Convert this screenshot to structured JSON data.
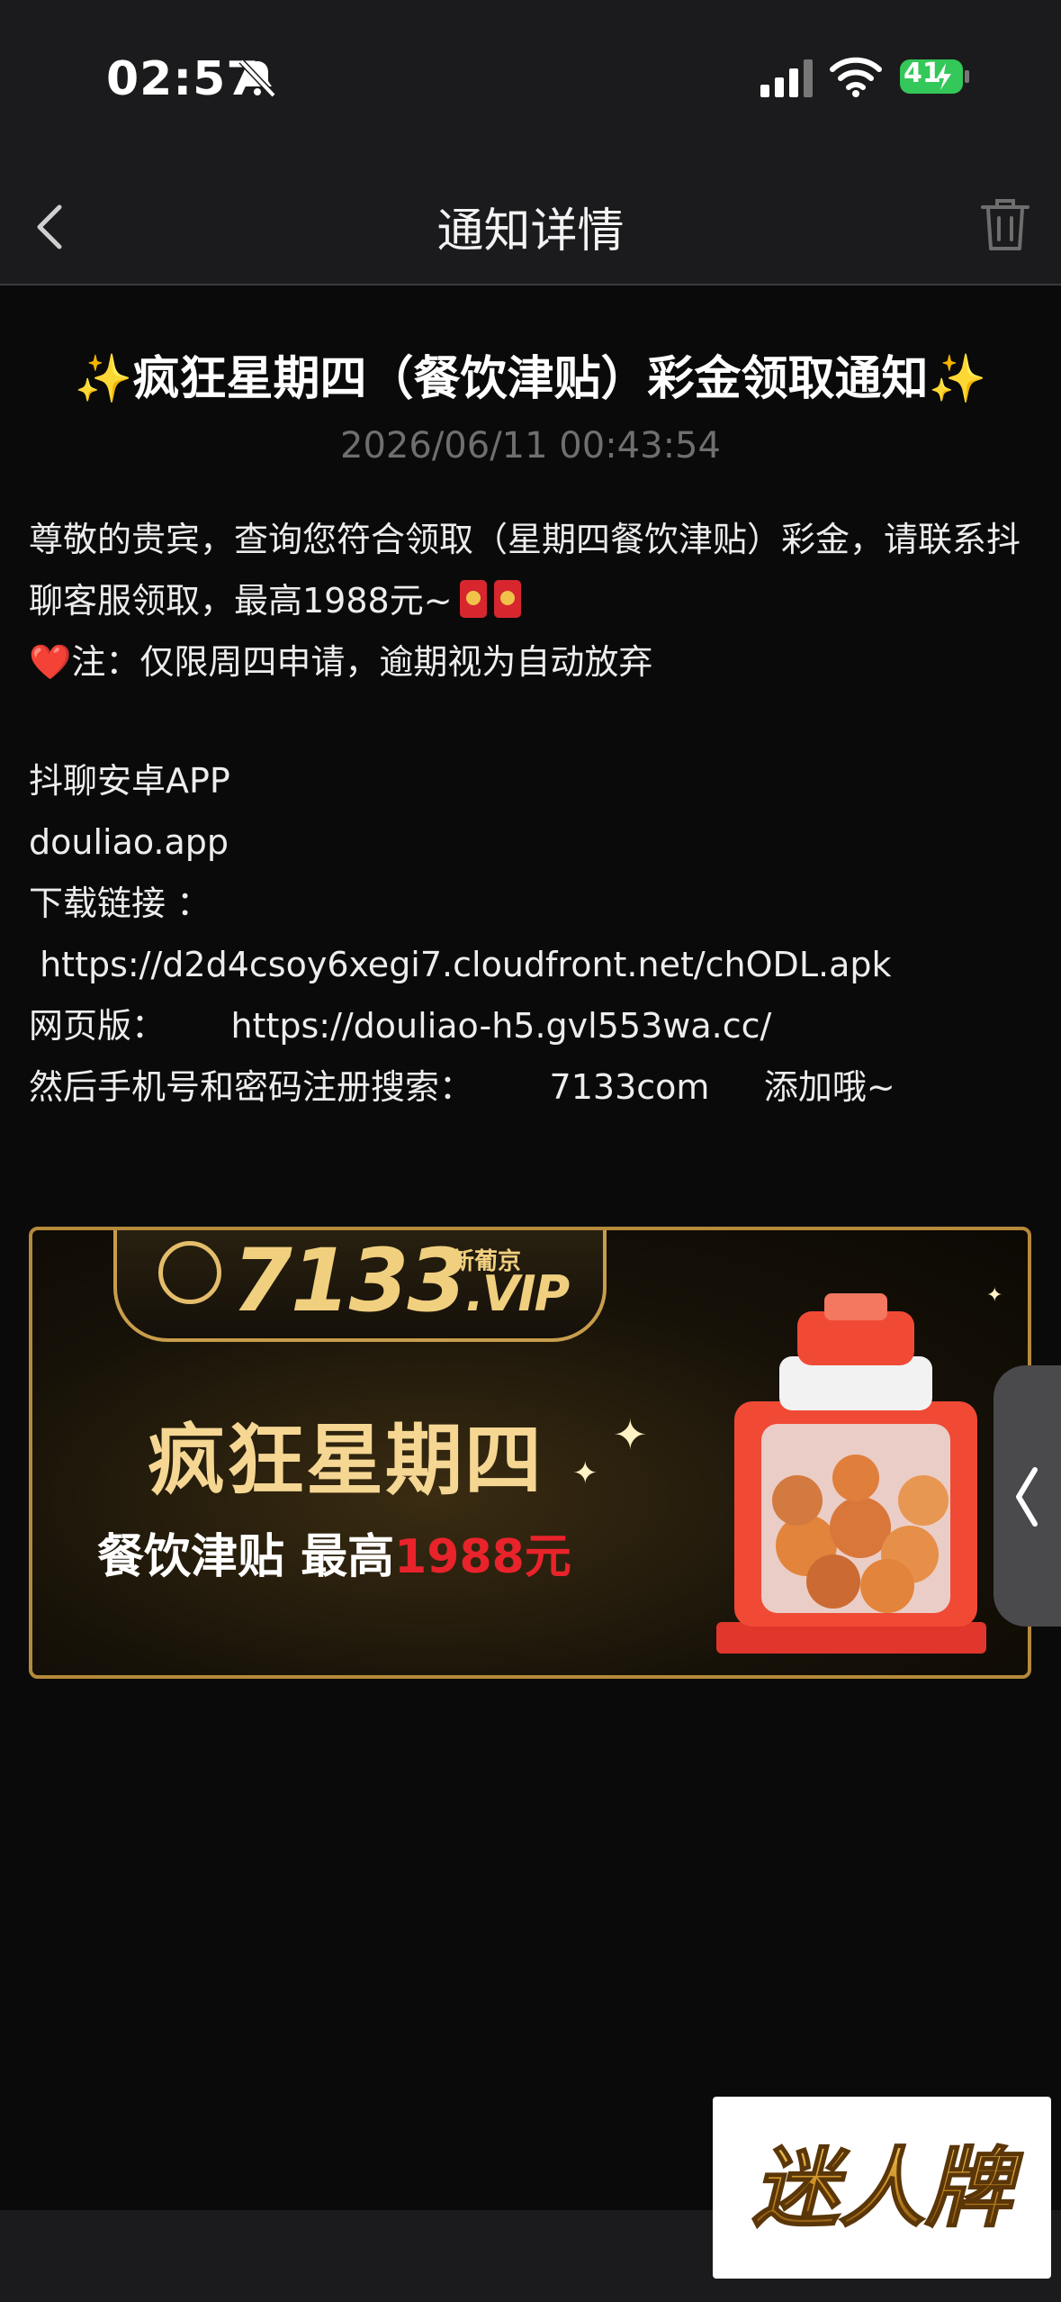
{
  "status_bar": {
    "time": "02:57",
    "battery": "41",
    "icons": [
      "bell-slash-icon",
      "cellular-signal-icon",
      "wifi-icon",
      "battery-charging-icon"
    ]
  },
  "nav": {
    "title": "通知详情",
    "back_icon": "chevron-left-icon",
    "trash_icon": "trash-icon"
  },
  "notice": {
    "sparkle": "✨",
    "title": "疯狂星期四（餐饮津贴）彩金领取通知",
    "timestamp": "2026/06/11 00:43:54",
    "line1": "尊敬的贵宾，查询您符合领取（星期四餐饮津贴）彩金，请联系抖",
    "line2": "聊客服领取，最高1988元~",
    "heart": "❤️",
    "line3": "注：仅限周四申请，逾期视为自动放弃",
    "line4": "抖聊安卓APP",
    "line5": "douliao.app",
    "line6": "下载链接 ：",
    "line7": " https://d2d4csoy6xegi7.cloudfront.net/chODL.apk",
    "line8": "网页版：      https://douliao-h5.gvl553wa.cc/",
    "line9": "然后手机号和密码注册搜索：       7133com     添加哦~"
  },
  "banner": {
    "logo": "7133",
    "logo_suffix": ".VIP",
    "logo_tag": "新葡京",
    "headline": "疯狂星期四",
    "sub_prefix": "餐饮津贴 最高",
    "sub_amount": "1988元"
  },
  "watermark": {
    "text": "迷人牌"
  },
  "colors": {
    "background": "#0a0a0a",
    "bar": "#1b1b1d",
    "accent_gold": "#f0cf7e",
    "accent_red": "#e8232b",
    "battery_green": "#34c759"
  }
}
